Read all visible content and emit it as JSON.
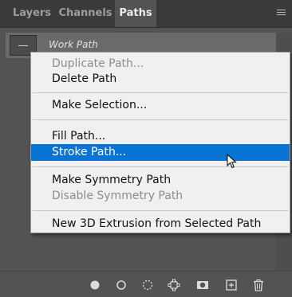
{
  "tabs": [
    {
      "label": "Layers"
    },
    {
      "label": "Channels"
    },
    {
      "label": "Paths"
    }
  ],
  "active_tab": "Paths",
  "path_row": {
    "name": "Work Path"
  },
  "context_menu": {
    "items": [
      {
        "label": "Duplicate Path...",
        "enabled": false
      },
      {
        "label": "Delete Path",
        "enabled": true
      },
      {
        "label": "Make Selection...",
        "enabled": true
      },
      {
        "label": "Fill Path...",
        "enabled": true
      },
      {
        "label": "Stroke Path...",
        "enabled": true,
        "highlighted": true
      },
      {
        "label": "Make Symmetry Path",
        "enabled": true
      },
      {
        "label": "Disable Symmetry Path",
        "enabled": false
      },
      {
        "label": "New 3D Extrusion from Selected Path",
        "enabled": true
      }
    ]
  },
  "bottom_toolbar": {
    "icons": [
      "fill-path-icon",
      "stroke-path-icon",
      "load-selection-icon",
      "make-work-path-icon",
      "add-mask-icon",
      "new-path-icon",
      "delete-path-icon"
    ]
  },
  "colors": {
    "panel_bg": "#535353",
    "tabbar_bg": "#3a3a3a",
    "menu_bg": "#f0f0f0",
    "highlight": "#0a74d4"
  }
}
